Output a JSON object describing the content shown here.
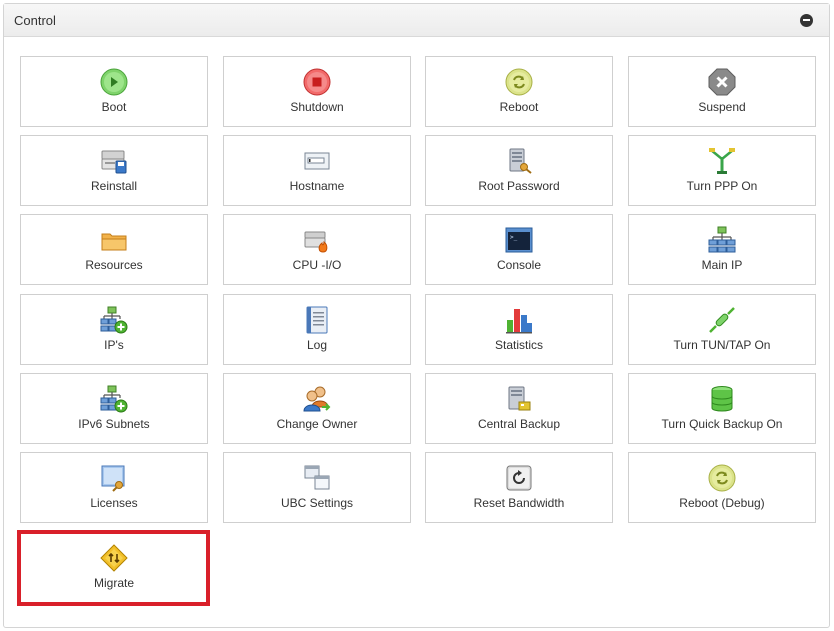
{
  "panel": {
    "title": "Control"
  },
  "tiles": [
    {
      "label": "Boot",
      "icon": "play-icon"
    },
    {
      "label": "Shutdown",
      "icon": "stop-icon"
    },
    {
      "label": "Reboot",
      "icon": "reboot-icon"
    },
    {
      "label": "Suspend",
      "icon": "suspend-icon"
    },
    {
      "label": "Reinstall",
      "icon": "reinstall-icon"
    },
    {
      "label": "Hostname",
      "icon": "hostname-icon"
    },
    {
      "label": "Root Password",
      "icon": "root-password-icon"
    },
    {
      "label": "Turn PPP On",
      "icon": "ppp-icon"
    },
    {
      "label": "Resources",
      "icon": "folder-icon"
    },
    {
      "label": "CPU -I/O",
      "icon": "cpu-io-icon"
    },
    {
      "label": "Console",
      "icon": "console-icon"
    },
    {
      "label": "Main IP",
      "icon": "network-icon"
    },
    {
      "label": "IP's",
      "icon": "network-add-icon"
    },
    {
      "label": "Log",
      "icon": "log-icon"
    },
    {
      "label": "Statistics",
      "icon": "bar-chart-icon"
    },
    {
      "label": "Turn TUN/TAP On",
      "icon": "plug-icon"
    },
    {
      "label": "IPv6 Subnets",
      "icon": "network-add-icon"
    },
    {
      "label": "Change Owner",
      "icon": "users-icon"
    },
    {
      "label": "Central Backup",
      "icon": "backup-icon"
    },
    {
      "label": "Turn Quick Backup On",
      "icon": "database-icon"
    },
    {
      "label": "Licenses",
      "icon": "license-icon"
    },
    {
      "label": "UBC Settings",
      "icon": "windows-icon"
    },
    {
      "label": "Reset Bandwidth",
      "icon": "reset-icon"
    },
    {
      "label": "Reboot (Debug)",
      "icon": "reboot-icon"
    },
    {
      "label": "Migrate",
      "icon": "migrate-icon"
    }
  ]
}
